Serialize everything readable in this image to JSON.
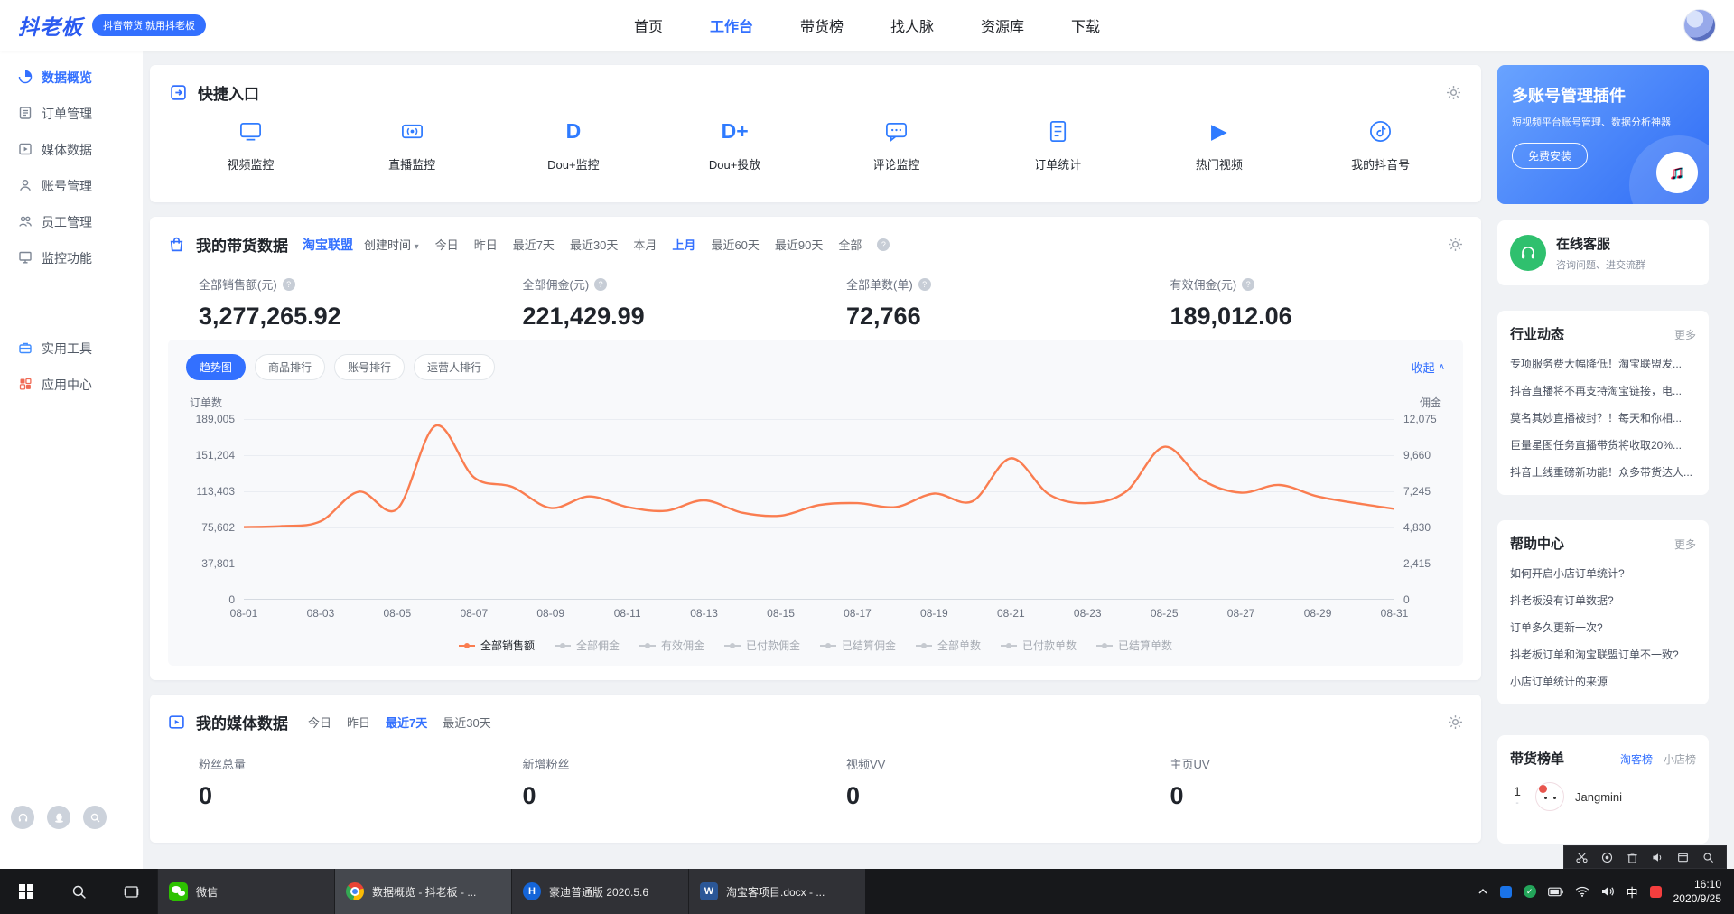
{
  "colors": {
    "primary": "#3370ff",
    "chart_line": "#fa7d50",
    "promo_gradient_start": "#69a3ff",
    "promo_gradient_end": "#2f6cf5"
  },
  "icons": {
    "caret_down": "▾",
    "collapse_caret": "∧",
    "question": "?",
    "dou_d": "D",
    "dou_d_plus": "D+",
    "play": "▶",
    "note": "♪",
    "douyin_note": "♫",
    "check": "✓"
  },
  "navbar": {
    "logo": "抖老板",
    "logo_badge": "抖音带货 就用抖老板",
    "items": [
      {
        "label": "首页",
        "active": false
      },
      {
        "label": "工作台",
        "active": true
      },
      {
        "label": "带货榜",
        "active": false
      },
      {
        "label": "找人脉",
        "active": false
      },
      {
        "label": "资源库",
        "active": false
      },
      {
        "label": "下载",
        "active": false
      }
    ]
  },
  "sidebar": {
    "items": [
      {
        "label": "数据概览",
        "active": true
      },
      {
        "label": "订单管理",
        "active": false
      },
      {
        "label": "媒体数据",
        "active": false
      },
      {
        "label": "账号管理",
        "active": false
      },
      {
        "label": "员工管理",
        "active": false
      },
      {
        "label": "监控功能",
        "active": false
      }
    ],
    "tools": [
      {
        "label": "实用工具"
      },
      {
        "label": "应用中心"
      }
    ]
  },
  "quick_entry": {
    "title": "快捷入口",
    "items": [
      "视频监控",
      "直播监控",
      "Dou+监控",
      "Dou+投放",
      "评论监控",
      "订单统计",
      "热门视频",
      "我的抖音号"
    ]
  },
  "sales_card": {
    "title": "我的带货数据",
    "source_tab": "淘宝联盟",
    "sort_dropdown": "创建时间",
    "filters": [
      "今日",
      "昨日",
      "最近7天",
      "最近30天",
      "本月",
      "上月",
      "最近60天",
      "最近90天",
      "全部"
    ],
    "active_filter": "上月",
    "stats": [
      {
        "label": "全部销售额(元)",
        "value": "3,277,265.92"
      },
      {
        "label": "全部佣金(元)",
        "value": "221,429.99"
      },
      {
        "label": "全部单数(单)",
        "value": "72,766"
      },
      {
        "label": "有效佣金(元)",
        "value": "189,012.06"
      }
    ],
    "chart_tabs": [
      "趋势图",
      "商品排行",
      "账号排行",
      "运营人排行"
    ],
    "active_chart_tab": "趋势图",
    "collapse_label": "收起"
  },
  "chart_data": {
    "type": "line",
    "title": "我的带货数据趋势图",
    "x_ticks": [
      "08-01",
      "08-03",
      "08-05",
      "08-07",
      "08-09",
      "08-11",
      "08-13",
      "08-15",
      "08-17",
      "08-19",
      "08-21",
      "08-23",
      "08-25",
      "08-27",
      "08-29",
      "08-31"
    ],
    "left_axis": {
      "label": "订单数",
      "max": 189005,
      "ticks": [
        "189,005",
        "151,204",
        "113,403",
        "75,602",
        "37,801",
        "0"
      ]
    },
    "right_axis": {
      "label": "佣金",
      "max": 12075,
      "ticks": [
        "12,075",
        "9,660",
        "7,245",
        "4,830",
        "2,415",
        "0"
      ]
    },
    "series": [
      {
        "name": "全部销售额",
        "color": "#fa7d50",
        "values": [
          76000,
          77000,
          82000,
          113000,
          95000,
          182000,
          128000,
          118000,
          96000,
          108000,
          97000,
          93000,
          104000,
          91000,
          88000,
          99000,
          101000,
          97000,
          111000,
          103000,
          148000,
          110000,
          101000,
          113000,
          160000,
          125000,
          112000,
          120000,
          108000,
          101000,
          95000
        ]
      }
    ],
    "legend": [
      {
        "label": "全部销售额",
        "active": true
      },
      {
        "label": "全部佣金",
        "active": false
      },
      {
        "label": "有效佣金",
        "active": false
      },
      {
        "label": "已付款佣金",
        "active": false
      },
      {
        "label": "已结算佣金",
        "active": false
      },
      {
        "label": "全部单数",
        "active": false
      },
      {
        "label": "已付款单数",
        "active": false
      },
      {
        "label": "已结算单数",
        "active": false
      }
    ],
    "grid": true,
    "legend_position": "bottom"
  },
  "media_card": {
    "title": "我的媒体数据",
    "filters": [
      "今日",
      "昨日",
      "最近7天",
      "最近30天"
    ],
    "active_filter": "最近7天",
    "stats": [
      {
        "label": "粉丝总量",
        "value": "0"
      },
      {
        "label": "新增粉丝",
        "value": "0"
      },
      {
        "label": "视频VV",
        "value": "0"
      },
      {
        "label": "主页UV",
        "value": "0"
      }
    ]
  },
  "right_panel": {
    "promo": {
      "title": "多账号管理插件",
      "subtitle": "短视频平台账号管理、数据分析神器",
      "button": "免费安装"
    },
    "service": {
      "title": "在线客服",
      "subtitle": "咨询问题、进交流群"
    },
    "news": {
      "title": "行业动态",
      "more": "更多",
      "items": [
        "专项服务费大幅降低！淘宝联盟发...",
        "抖音直播将不再支持淘宝链接，电...",
        "莫名其妙直播被封？！每天和你相...",
        "巨量星图任务直播带货将收取20%...",
        "抖音上线重磅新功能！众多带货达人..."
      ]
    },
    "help": {
      "title": "帮助中心",
      "more": "更多",
      "items": [
        "如何开启小店订单统计?",
        "抖老板没有订单数据?",
        "订单多久更新一次?",
        "抖老板订单和淘宝联盟订单不一致?",
        "小店订单统计的来源"
      ]
    },
    "rank": {
      "title": "带货榜单",
      "tabs": [
        "淘客榜",
        "小店榜"
      ],
      "rows": [
        {
          "rank": "1",
          "change": "-",
          "name": "Jangmini"
        }
      ]
    }
  },
  "taskbar": {
    "apps": [
      {
        "label": "微信"
      },
      {
        "label": "数据概览 - 抖老板 - ..."
      },
      {
        "label": "豪迪普通版 2020.5.6",
        "letter": "H"
      },
      {
        "label": "淘宝客项目.docx - ...",
        "letter": "W"
      }
    ],
    "ime": "中",
    "clock": {
      "time": "16:10",
      "date": "2020/9/25"
    }
  }
}
